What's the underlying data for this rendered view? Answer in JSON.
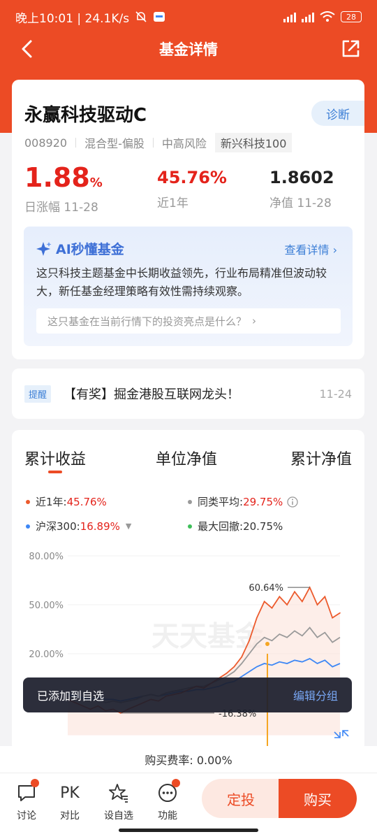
{
  "status": {
    "time_speed": "晚上10:01 | 24.1K/s",
    "battery": "28"
  },
  "header": {
    "title": "基金详情"
  },
  "fund": {
    "name": "永赢科技驱动C",
    "diagnose_label": "诊断",
    "code": "008920",
    "type": "混合型-偏股",
    "risk": "中高风险",
    "index_tag": "新兴科技100",
    "daily_change_value": "1.88",
    "daily_change_unit": "%",
    "daily_change_label": "日涨幅 11-28",
    "year_return": "45.76%",
    "year_return_label": "近1年",
    "nav": "1.8602",
    "nav_label": "净值 11-28"
  },
  "ai": {
    "title": "AI秒懂基金",
    "more": "查看详情",
    "summary": "这只科技主题基金中长期收益领先，行业布局精准但波动较大，新任基金经理策略有效性需持续观察。",
    "question": "这只基金在当前行情下的投资亮点是什么？"
  },
  "reminder": {
    "tag": "提醒",
    "text": "【有奖】掘金港股互联网龙头！",
    "date": "11-24"
  },
  "chart_tabs": [
    "累计收益",
    "单位净值",
    "累计净值"
  ],
  "legend": {
    "fund": {
      "label": "近1年:",
      "value": "45.76%"
    },
    "peer": {
      "label": "同类平均:",
      "value": "29.75%"
    },
    "hs300": {
      "label": "沪深300:",
      "value": "16.89%"
    },
    "drawdown": {
      "label": "最大回撤:",
      "value": "20.75%"
    }
  },
  "chart_data": {
    "type": "line",
    "y_tick_labels": [
      "80.00%",
      "50.00%",
      "20.00%"
    ],
    "ylim": [
      -30,
      85
    ],
    "annotations": {
      "max": "60.64%",
      "min": "-16.38%"
    },
    "watermark": "天天基金",
    "series": [
      {
        "name": "近1年",
        "color": "#ec5a2c",
        "values": [
          -8,
          -10,
          -12,
          -14,
          -12,
          -15,
          -14,
          -16.38,
          -14,
          -12,
          -10,
          -8,
          -9,
          -6,
          -5,
          -4,
          -2,
          0,
          -1,
          2,
          5,
          8,
          12,
          18,
          28,
          42,
          52,
          48,
          55,
          50,
          58,
          52,
          60.64,
          50,
          55,
          42,
          45
        ]
      },
      {
        "name": "同类平均",
        "color": "#9a9a9a",
        "values": [
          -6,
          -7,
          -8,
          -9,
          -8,
          -10,
          -9,
          -10,
          -9,
          -8,
          -6,
          -5,
          -6,
          -4,
          -3,
          -2,
          -1,
          0,
          0,
          2,
          4,
          6,
          9,
          14,
          20,
          26,
          30,
          28,
          32,
          30,
          34,
          31,
          36,
          30,
          33,
          27,
          30
        ]
      },
      {
        "name": "沪深300",
        "color": "#3d87f5",
        "values": [
          -5,
          -6,
          -7,
          -8,
          -7,
          -8,
          -8,
          -9,
          -8,
          -7,
          -6,
          -5,
          -6,
          -5,
          -4,
          -3,
          -3,
          -2,
          -2,
          -1,
          0,
          2,
          3,
          6,
          9,
          12,
          14,
          13,
          15,
          14,
          16,
          15,
          17,
          14,
          16,
          12,
          14
        ]
      }
    ]
  },
  "toast": {
    "text": "已添加到自选",
    "action": "编辑分组"
  },
  "fee": {
    "text": "购买费率: 0.00%"
  },
  "bottom": {
    "discuss": "讨论",
    "pk_icon": "PK",
    "pk": "对比",
    "watch": "设自选",
    "func": "功能",
    "dingtou": "定投",
    "buy": "购买"
  },
  "colors": {
    "brand": "#ec4b25",
    "rise": "#e4231b",
    "link": "#3d7fd6"
  }
}
